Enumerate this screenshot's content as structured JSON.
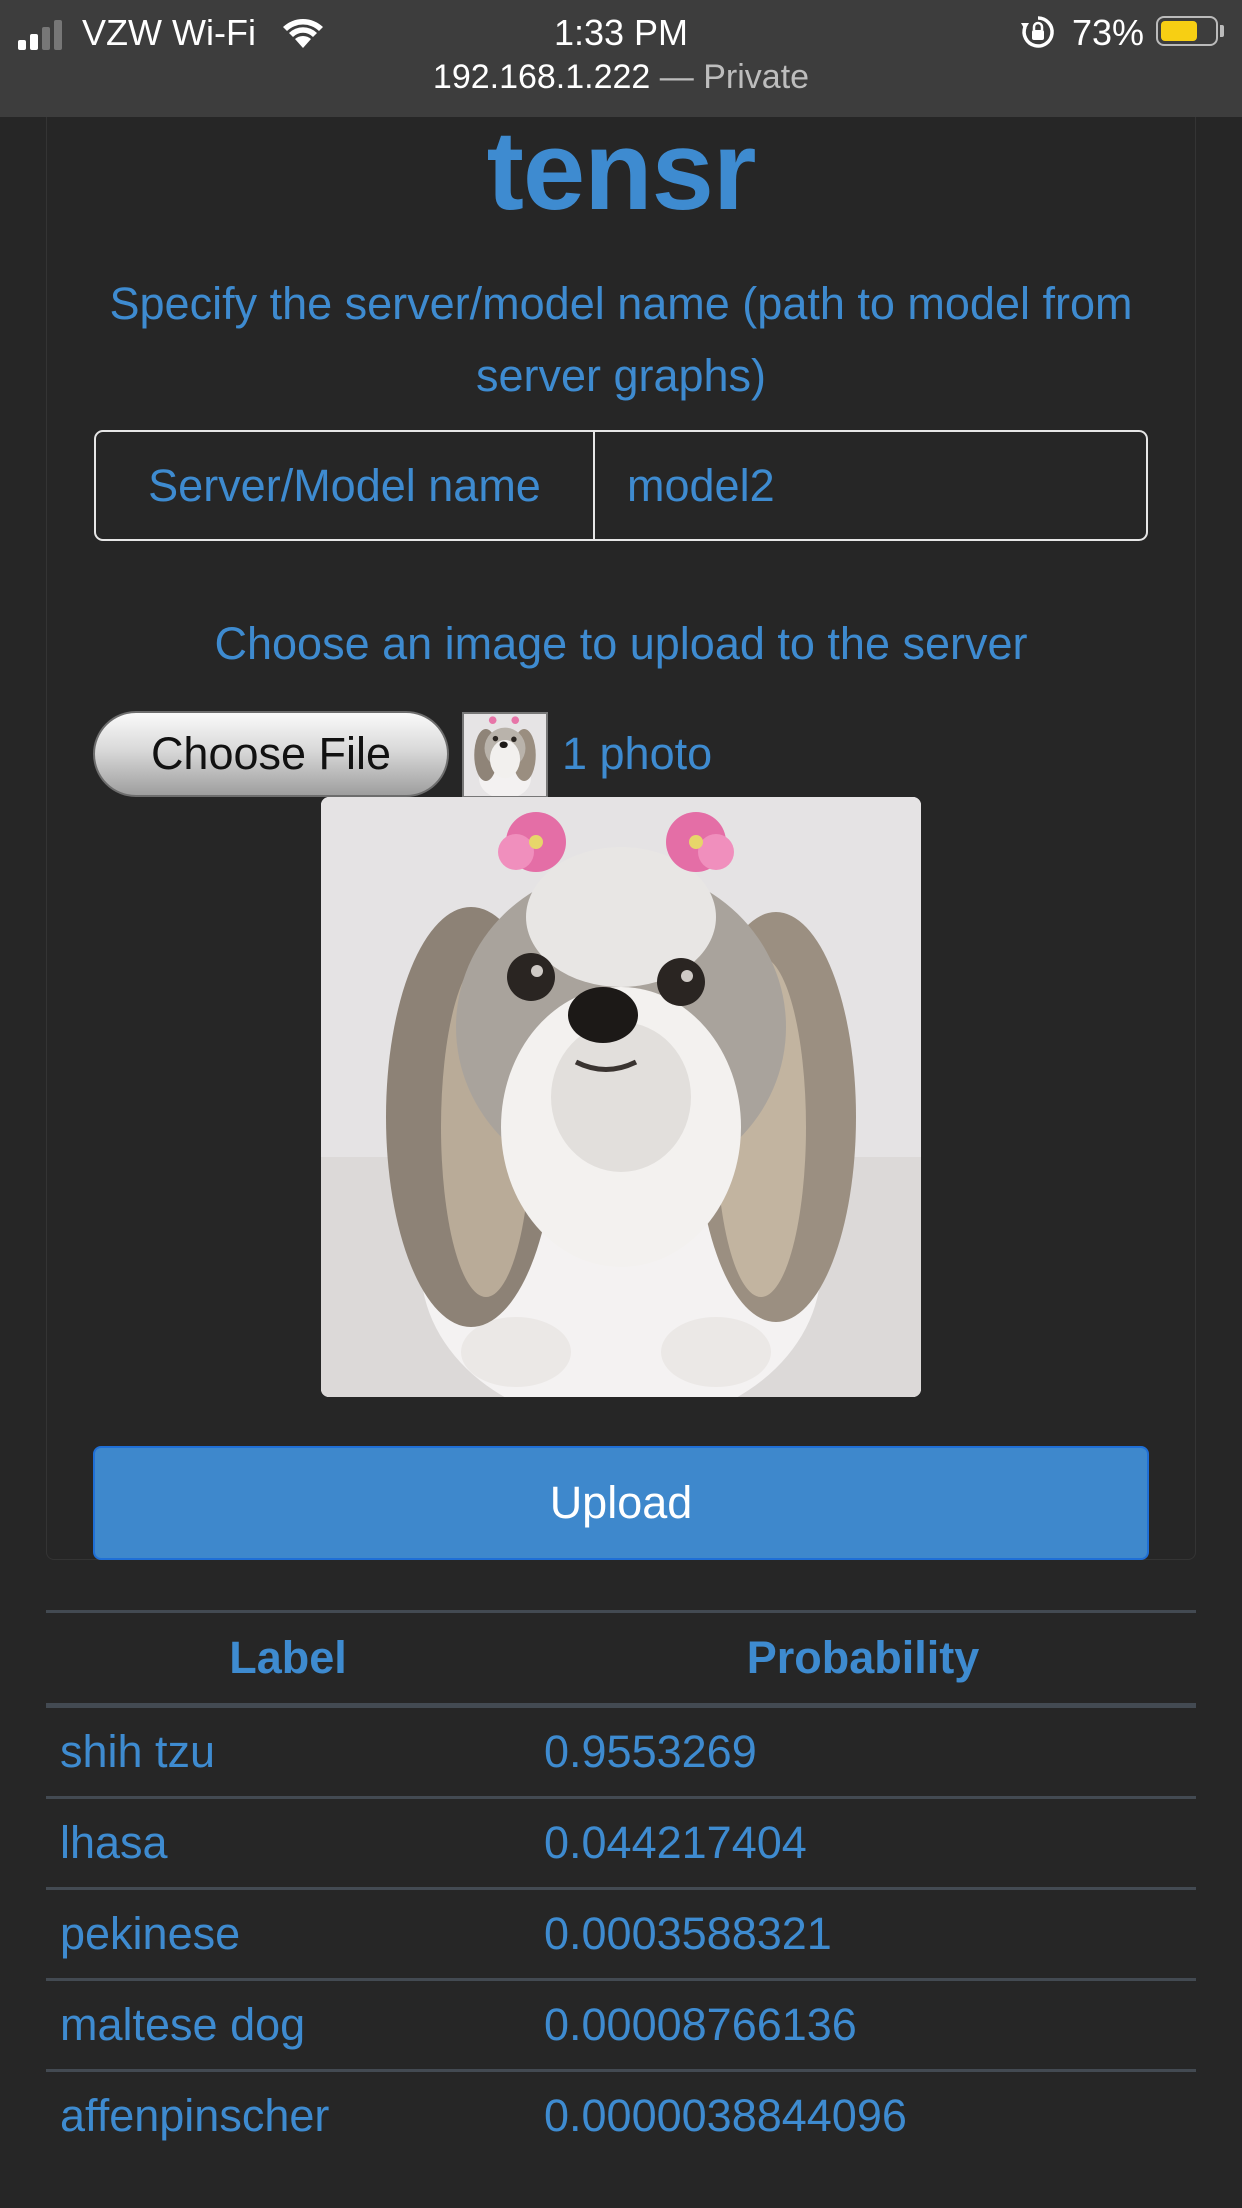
{
  "status_bar": {
    "carrier": "VZW Wi-Fi",
    "time": "1:33 PM",
    "battery_percent": "73%",
    "battery_level": 0.73,
    "battery_color": "#f7cf13"
  },
  "url_bar": {
    "host": "192.168.1.222",
    "separator": "—",
    "mode": "Private"
  },
  "page": {
    "brand": "tensr",
    "model_help": "Specify the server/model name (path to model from server graphs)",
    "model_label": "Server/Model name",
    "model_value": "model2",
    "upload_help": "Choose an image to upload to the server",
    "choose_file_label": "Choose File",
    "photo_count": "1 photo",
    "upload_label": "Upload",
    "accent_color": "#3e8bd0"
  },
  "results": {
    "headers": [
      "Label",
      "Probability"
    ],
    "rows": [
      {
        "label": "shih tzu",
        "probability": "0.9553269"
      },
      {
        "label": "lhasa",
        "probability": "0.044217404"
      },
      {
        "label": "pekinese",
        "probability": "0.0003588321"
      },
      {
        "label": "maltese dog",
        "probability": "0.00008766136"
      },
      {
        "label": "affenpinscher",
        "probability": "0.0000038844096"
      }
    ]
  }
}
